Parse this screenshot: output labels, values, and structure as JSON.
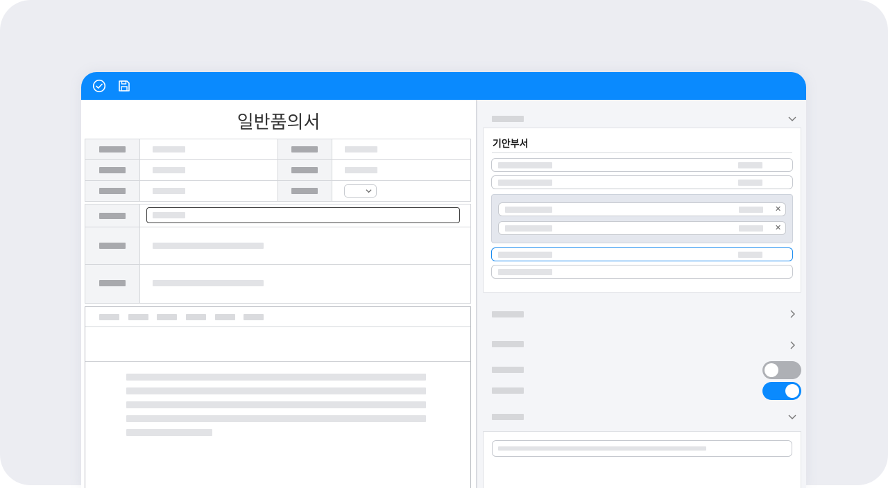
{
  "document": {
    "title": "일반품의서"
  },
  "panel": {
    "section_title": "기안부서"
  },
  "toggles": [
    {
      "state": "off"
    },
    {
      "state": "on"
    }
  ],
  "icons": {
    "check": "check-circle-icon",
    "save": "save-icon"
  },
  "colors": {
    "accent": "#0a8afe",
    "toggle_off": "#aeb0b5",
    "toggle_on": "#0a8afe"
  }
}
